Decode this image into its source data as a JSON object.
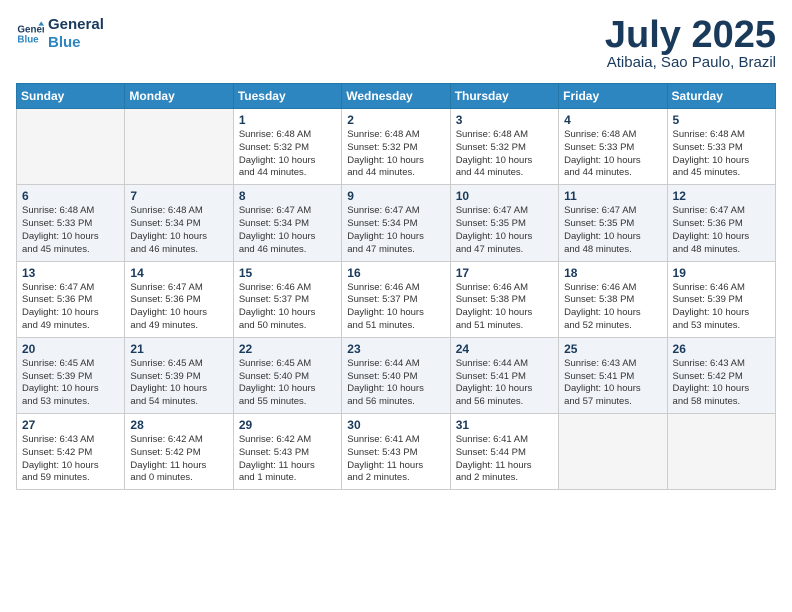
{
  "logo": {
    "line1": "General",
    "line2": "Blue"
  },
  "title": "July 2025",
  "subtitle": "Atibaia, Sao Paulo, Brazil",
  "days_of_week": [
    "Sunday",
    "Monday",
    "Tuesday",
    "Wednesday",
    "Thursday",
    "Friday",
    "Saturday"
  ],
  "weeks": [
    [
      {
        "day": "",
        "info": ""
      },
      {
        "day": "",
        "info": ""
      },
      {
        "day": "1",
        "info": "Sunrise: 6:48 AM\nSunset: 5:32 PM\nDaylight: 10 hours\nand 44 minutes."
      },
      {
        "day": "2",
        "info": "Sunrise: 6:48 AM\nSunset: 5:32 PM\nDaylight: 10 hours\nand 44 minutes."
      },
      {
        "day": "3",
        "info": "Sunrise: 6:48 AM\nSunset: 5:32 PM\nDaylight: 10 hours\nand 44 minutes."
      },
      {
        "day": "4",
        "info": "Sunrise: 6:48 AM\nSunset: 5:33 PM\nDaylight: 10 hours\nand 44 minutes."
      },
      {
        "day": "5",
        "info": "Sunrise: 6:48 AM\nSunset: 5:33 PM\nDaylight: 10 hours\nand 45 minutes."
      }
    ],
    [
      {
        "day": "6",
        "info": "Sunrise: 6:48 AM\nSunset: 5:33 PM\nDaylight: 10 hours\nand 45 minutes."
      },
      {
        "day": "7",
        "info": "Sunrise: 6:48 AM\nSunset: 5:34 PM\nDaylight: 10 hours\nand 46 minutes."
      },
      {
        "day": "8",
        "info": "Sunrise: 6:47 AM\nSunset: 5:34 PM\nDaylight: 10 hours\nand 46 minutes."
      },
      {
        "day": "9",
        "info": "Sunrise: 6:47 AM\nSunset: 5:34 PM\nDaylight: 10 hours\nand 47 minutes."
      },
      {
        "day": "10",
        "info": "Sunrise: 6:47 AM\nSunset: 5:35 PM\nDaylight: 10 hours\nand 47 minutes."
      },
      {
        "day": "11",
        "info": "Sunrise: 6:47 AM\nSunset: 5:35 PM\nDaylight: 10 hours\nand 48 minutes."
      },
      {
        "day": "12",
        "info": "Sunrise: 6:47 AM\nSunset: 5:36 PM\nDaylight: 10 hours\nand 48 minutes."
      }
    ],
    [
      {
        "day": "13",
        "info": "Sunrise: 6:47 AM\nSunset: 5:36 PM\nDaylight: 10 hours\nand 49 minutes."
      },
      {
        "day": "14",
        "info": "Sunrise: 6:47 AM\nSunset: 5:36 PM\nDaylight: 10 hours\nand 49 minutes."
      },
      {
        "day": "15",
        "info": "Sunrise: 6:46 AM\nSunset: 5:37 PM\nDaylight: 10 hours\nand 50 minutes."
      },
      {
        "day": "16",
        "info": "Sunrise: 6:46 AM\nSunset: 5:37 PM\nDaylight: 10 hours\nand 51 minutes."
      },
      {
        "day": "17",
        "info": "Sunrise: 6:46 AM\nSunset: 5:38 PM\nDaylight: 10 hours\nand 51 minutes."
      },
      {
        "day": "18",
        "info": "Sunrise: 6:46 AM\nSunset: 5:38 PM\nDaylight: 10 hours\nand 52 minutes."
      },
      {
        "day": "19",
        "info": "Sunrise: 6:46 AM\nSunset: 5:39 PM\nDaylight: 10 hours\nand 53 minutes."
      }
    ],
    [
      {
        "day": "20",
        "info": "Sunrise: 6:45 AM\nSunset: 5:39 PM\nDaylight: 10 hours\nand 53 minutes."
      },
      {
        "day": "21",
        "info": "Sunrise: 6:45 AM\nSunset: 5:39 PM\nDaylight: 10 hours\nand 54 minutes."
      },
      {
        "day": "22",
        "info": "Sunrise: 6:45 AM\nSunset: 5:40 PM\nDaylight: 10 hours\nand 55 minutes."
      },
      {
        "day": "23",
        "info": "Sunrise: 6:44 AM\nSunset: 5:40 PM\nDaylight: 10 hours\nand 56 minutes."
      },
      {
        "day": "24",
        "info": "Sunrise: 6:44 AM\nSunset: 5:41 PM\nDaylight: 10 hours\nand 56 minutes."
      },
      {
        "day": "25",
        "info": "Sunrise: 6:43 AM\nSunset: 5:41 PM\nDaylight: 10 hours\nand 57 minutes."
      },
      {
        "day": "26",
        "info": "Sunrise: 6:43 AM\nSunset: 5:42 PM\nDaylight: 10 hours\nand 58 minutes."
      }
    ],
    [
      {
        "day": "27",
        "info": "Sunrise: 6:43 AM\nSunset: 5:42 PM\nDaylight: 10 hours\nand 59 minutes."
      },
      {
        "day": "28",
        "info": "Sunrise: 6:42 AM\nSunset: 5:42 PM\nDaylight: 11 hours\nand 0 minutes."
      },
      {
        "day": "29",
        "info": "Sunrise: 6:42 AM\nSunset: 5:43 PM\nDaylight: 11 hours\nand 1 minute."
      },
      {
        "day": "30",
        "info": "Sunrise: 6:41 AM\nSunset: 5:43 PM\nDaylight: 11 hours\nand 2 minutes."
      },
      {
        "day": "31",
        "info": "Sunrise: 6:41 AM\nSunset: 5:44 PM\nDaylight: 11 hours\nand 2 minutes."
      },
      {
        "day": "",
        "info": ""
      },
      {
        "day": "",
        "info": ""
      }
    ]
  ]
}
